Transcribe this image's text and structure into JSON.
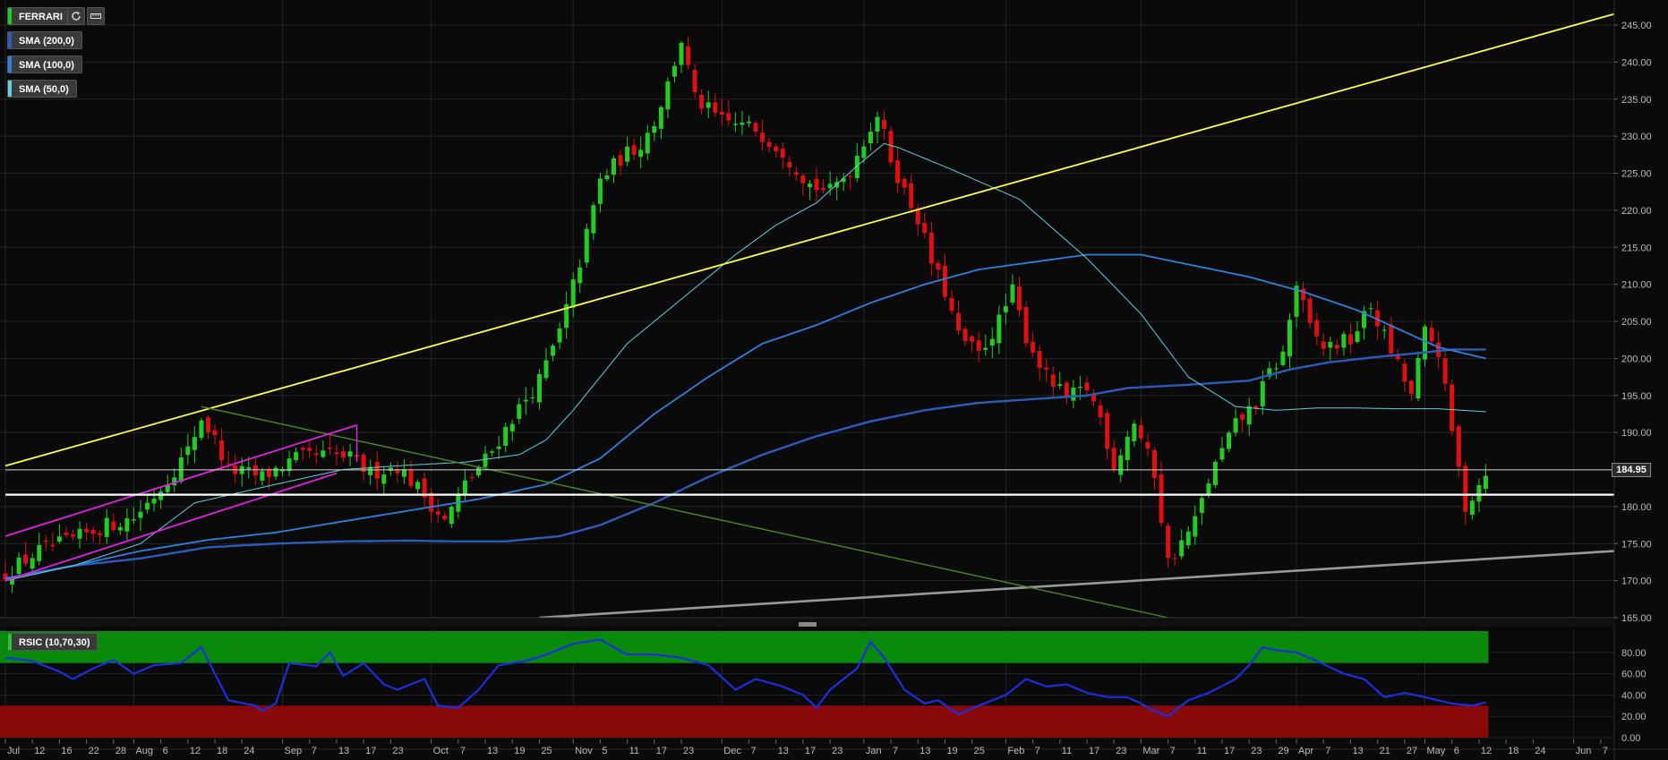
{
  "symbol": "FERRARI",
  "indicators": [
    {
      "label": "SMA (200,0)",
      "color": "#2c5cbb"
    },
    {
      "label": "SMA (100,0)",
      "color": "#2f7fe0"
    },
    {
      "label": "SMA (50,0)",
      "color": "#5fd0e0"
    }
  ],
  "oscillator_label": "RSIC (10,70,30)",
  "last_price_label": "184.95",
  "icons": {
    "refresh": "refresh-icon",
    "settings": "ruler-icon"
  },
  "colors": {
    "up": "#22cc22",
    "down": "#e01010",
    "trend_yellow": "#ffff44",
    "channel": "#e020e0",
    "downtrend": "#4a8a20",
    "support_gray": "#999999",
    "rsi_line": "#1c2ee0",
    "rsi_overbought_zone": "#0a8a0a",
    "rsi_oversold_zone": "#8a0a0a",
    "horizontal_level": "#ffffff"
  },
  "chart_data": [
    {
      "type": "candlestick",
      "title": "FERRARI",
      "ylim": [
        165,
        245
      ],
      "y_ticks": [
        "245.00",
        "240.00",
        "235.00",
        "230.00",
        "225.00",
        "220.00",
        "215.00",
        "210.00",
        "205.00",
        "200.00",
        "195.00",
        "190.00",
        "185.00",
        "180.00",
        "175.00",
        "170.00",
        "165.00"
      ],
      "x_ticks": [
        {
          "i": 0,
          "label": "Jul"
        },
        {
          "i": 4,
          "label": "12"
        },
        {
          "i": 8,
          "label": "16"
        },
        {
          "i": 12,
          "label": "22"
        },
        {
          "i": 16,
          "label": "28"
        },
        {
          "i": 19,
          "label": "Aug"
        },
        {
          "i": 23,
          "label": "6"
        },
        {
          "i": 27,
          "label": "12"
        },
        {
          "i": 31,
          "label": "18"
        },
        {
          "i": 35,
          "label": "24"
        },
        {
          "i": 41,
          "label": "Sep"
        },
        {
          "i": 45,
          "label": "7"
        },
        {
          "i": 49,
          "label": "13"
        },
        {
          "i": 53,
          "label": "17"
        },
        {
          "i": 57,
          "label": "23"
        },
        {
          "i": 63,
          "label": "Oct"
        },
        {
          "i": 67,
          "label": "7"
        },
        {
          "i": 71,
          "label": "13"
        },
        {
          "i": 75,
          "label": "19"
        },
        {
          "i": 79,
          "label": "25"
        },
        {
          "i": 84,
          "label": "Nov"
        },
        {
          "i": 88,
          "label": "5"
        },
        {
          "i": 92,
          "label": "11"
        },
        {
          "i": 96,
          "label": "17"
        },
        {
          "i": 100,
          "label": "23"
        },
        {
          "i": 106,
          "label": "Dec"
        },
        {
          "i": 110,
          "label": "7"
        },
        {
          "i": 114,
          "label": "13"
        },
        {
          "i": 118,
          "label": "17"
        },
        {
          "i": 122,
          "label": "23"
        },
        {
          "i": 127,
          "label": "Jan"
        },
        {
          "i": 131,
          "label": "7"
        },
        {
          "i": 135,
          "label": "13"
        },
        {
          "i": 139,
          "label": "19"
        },
        {
          "i": 143,
          "label": "25"
        },
        {
          "i": 148,
          "label": "Feb"
        },
        {
          "i": 152,
          "label": "7"
        },
        {
          "i": 156,
          "label": "11"
        },
        {
          "i": 160,
          "label": "17"
        },
        {
          "i": 164,
          "label": "23"
        },
        {
          "i": 168,
          "label": "Mar"
        },
        {
          "i": 172,
          "label": "7"
        },
        {
          "i": 176,
          "label": "11"
        },
        {
          "i": 180,
          "label": "17"
        },
        {
          "i": 184,
          "label": "23"
        },
        {
          "i": 188,
          "label": "29"
        },
        {
          "i": 191,
          "label": "Apr"
        },
        {
          "i": 195,
          "label": "7"
        },
        {
          "i": 199,
          "label": "13"
        },
        {
          "i": 203,
          "label": "21"
        },
        {
          "i": 207,
          "label": "27"
        },
        {
          "i": 210,
          "label": "May"
        },
        {
          "i": 214,
          "label": "6"
        },
        {
          "i": 218,
          "label": "12"
        },
        {
          "i": 222,
          "label": "18"
        },
        {
          "i": 226,
          "label": "24"
        },
        {
          "i": 232,
          "label": "Jun"
        },
        {
          "i": 236,
          "label": "7"
        }
      ],
      "close_path": [
        [
          0,
          171
        ],
        [
          5,
          174
        ],
        [
          10,
          175.5
        ],
        [
          15,
          177.5
        ],
        [
          19,
          178.5
        ],
        [
          23,
          182.5
        ],
        [
          27,
          187.5
        ],
        [
          29,
          192
        ],
        [
          31,
          189
        ],
        [
          33,
          185
        ],
        [
          38,
          184
        ],
        [
          43,
          186.5
        ],
        [
          48,
          187
        ],
        [
          51,
          186.5
        ],
        [
          54,
          184.5
        ],
        [
          58,
          185.5
        ],
        [
          62,
          181.5
        ],
        [
          65,
          178
        ],
        [
          68,
          183
        ],
        [
          72,
          187.5
        ],
        [
          75,
          192
        ],
        [
          79,
          197
        ],
        [
          82,
          203.5
        ],
        [
          85,
          213
        ],
        [
          88,
          224
        ],
        [
          91,
          227
        ],
        [
          94,
          229
        ],
        [
          96,
          232
        ],
        [
          98,
          237
        ],
        [
          100,
          243
        ],
        [
          102,
          235
        ],
        [
          106,
          232
        ],
        [
          111,
          231
        ],
        [
          115,
          228
        ],
        [
          119,
          223.5
        ],
        [
          122,
          222.5
        ],
        [
          125,
          225.5
        ],
        [
          127,
          229.5
        ],
        [
          129,
          233
        ],
        [
          131,
          227
        ],
        [
          133,
          222.5
        ],
        [
          135,
          219
        ],
        [
          137,
          213
        ],
        [
          139,
          209
        ],
        [
          141,
          203
        ],
        [
          144,
          200.5
        ],
        [
          147,
          205
        ],
        [
          149,
          209
        ],
        [
          151,
          203
        ],
        [
          154,
          197.5
        ],
        [
          157,
          194.5
        ],
        [
          160,
          196
        ],
        [
          162,
          192
        ],
        [
          164,
          185.5
        ],
        [
          167,
          191.5
        ],
        [
          170,
          184.5
        ],
        [
          172,
          172.5
        ],
        [
          174,
          175
        ],
        [
          176,
          178
        ],
        [
          178,
          183.5
        ],
        [
          180,
          187.5
        ],
        [
          182,
          191
        ],
        [
          185,
          194
        ],
        [
          187,
          198
        ],
        [
          189,
          200.5
        ],
        [
          191,
          210
        ],
        [
          193,
          204
        ],
        [
          195,
          201.5
        ],
        [
          199,
          202.5
        ],
        [
          202,
          207
        ],
        [
          204,
          203
        ],
        [
          206,
          199
        ],
        [
          208,
          195
        ],
        [
          210,
          203.5
        ],
        [
          212,
          201
        ],
        [
          214,
          190
        ],
        [
          216,
          180
        ],
        [
          218,
          183
        ],
        [
          219,
          185
        ]
      ],
      "sma50_path": [
        [
          0,
          170
        ],
        [
          10,
          172
        ],
        [
          20,
          175
        ],
        [
          28,
          180.5
        ],
        [
          40,
          183
        ],
        [
          50,
          185
        ],
        [
          58,
          185.5
        ],
        [
          68,
          186
        ],
        [
          76,
          187
        ],
        [
          80,
          189
        ],
        [
          84,
          193
        ],
        [
          92,
          202
        ],
        [
          100,
          208
        ],
        [
          108,
          214
        ],
        [
          114,
          218
        ],
        [
          120,
          221
        ],
        [
          126,
          226
        ],
        [
          130,
          229
        ],
        [
          132,
          228.5
        ],
        [
          136,
          227
        ],
        [
          140,
          225.5
        ],
        [
          150,
          221.5
        ],
        [
          160,
          213.5
        ],
        [
          168,
          206
        ],
        [
          175,
          197.5
        ],
        [
          182,
          193.5
        ],
        [
          188,
          193
        ],
        [
          194,
          193.3
        ],
        [
          200,
          193.3
        ],
        [
          206,
          193.2
        ],
        [
          212,
          193.2
        ],
        [
          219,
          192.8
        ]
      ],
      "sma100_path": [
        [
          0,
          170.3
        ],
        [
          10,
          172
        ],
        [
          20,
          174
        ],
        [
          30,
          175.5
        ],
        [
          40,
          176.5
        ],
        [
          50,
          178
        ],
        [
          60,
          179.5
        ],
        [
          70,
          181
        ],
        [
          80,
          183
        ],
        [
          88,
          186.5
        ],
        [
          96,
          192.5
        ],
        [
          104,
          197.5
        ],
        [
          112,
          202
        ],
        [
          120,
          204.5
        ],
        [
          128,
          207.5
        ],
        [
          136,
          210
        ],
        [
          144,
          212
        ],
        [
          152,
          213
        ],
        [
          160,
          214
        ],
        [
          168,
          214
        ],
        [
          176,
          212.5
        ],
        [
          184,
          211
        ],
        [
          192,
          209
        ],
        [
          200,
          206.5
        ],
        [
          206,
          204
        ],
        [
          212,
          201.5
        ],
        [
          219,
          200
        ]
      ],
      "sma200_path": [
        [
          0,
          170.3
        ],
        [
          10,
          172
        ],
        [
          20,
          173
        ],
        [
          30,
          174.5
        ],
        [
          40,
          175
        ],
        [
          50,
          175.3
        ],
        [
          60,
          175.4
        ],
        [
          66,
          175.3
        ],
        [
          74,
          175.3
        ],
        [
          82,
          176
        ],
        [
          88,
          177.5
        ],
        [
          96,
          180.5
        ],
        [
          104,
          184
        ],
        [
          112,
          187
        ],
        [
          120,
          189.5
        ],
        [
          128,
          191.5
        ],
        [
          136,
          193
        ],
        [
          144,
          194
        ],
        [
          152,
          194.5
        ],
        [
          160,
          195
        ],
        [
          166,
          196
        ],
        [
          176,
          196.5
        ],
        [
          184,
          197
        ],
        [
          190,
          198.5
        ],
        [
          196,
          199.5
        ],
        [
          204,
          200.3
        ],
        [
          210,
          200.8
        ],
        [
          214,
          201.2
        ],
        [
          219,
          201.2
        ]
      ],
      "trendlines": [
        {
          "name": "rising-resistance",
          "from": [
            0,
            185.5
          ],
          "to": [
            240,
            246.5
          ]
        },
        {
          "name": "long-term-support",
          "from": [
            79,
            165
          ],
          "to": [
            240,
            174
          ]
        },
        {
          "name": "falling-trendline",
          "from": [
            29,
            193.5
          ],
          "to": [
            172,
            165
          ]
        },
        {
          "name": "channel-upper",
          "from": [
            0,
            176
          ],
          "to": [
            52,
            191
          ]
        },
        {
          "name": "channel-lower",
          "from": [
            0,
            170
          ],
          "to": [
            49,
            184.5
          ]
        },
        {
          "name": "horizontal-support",
          "from": [
            0,
            181.6
          ],
          "to": [
            240,
            181.6
          ]
        },
        {
          "name": "last-price",
          "from": [
            0,
            184.95
          ],
          "to": [
            240,
            184.95
          ]
        }
      ],
      "last_price": 184.95
    },
    {
      "type": "line",
      "title": "RSIC (10,70,30)",
      "ylim": [
        0,
        100
      ],
      "y_ticks": [
        "80.00",
        "60.00",
        "40.00",
        "20.00",
        "0.00"
      ],
      "zones": [
        {
          "from": 70,
          "to": 100,
          "name": "overbought"
        },
        {
          "from": 0,
          "to": 30,
          "name": "oversold"
        }
      ],
      "rsi_path": [
        [
          0,
          75
        ],
        [
          4,
          72
        ],
        [
          8,
          62
        ],
        [
          10,
          55
        ],
        [
          13,
          65
        ],
        [
          16,
          73
        ],
        [
          19,
          60
        ],
        [
          22,
          68
        ],
        [
          26,
          70
        ],
        [
          29,
          85
        ],
        [
          31,
          60
        ],
        [
          33,
          35
        ],
        [
          37,
          30
        ],
        [
          38,
          25
        ],
        [
          40,
          32
        ],
        [
          42,
          70
        ],
        [
          46,
          67
        ],
        [
          48,
          80
        ],
        [
          50,
          58
        ],
        [
          53,
          70
        ],
        [
          56,
          50
        ],
        [
          58,
          45
        ],
        [
          62,
          55
        ],
        [
          64,
          30
        ],
        [
          67,
          28
        ],
        [
          70,
          45
        ],
        [
          73,
          68
        ],
        [
          77,
          72
        ],
        [
          80,
          78
        ],
        [
          84,
          88
        ],
        [
          88,
          92
        ],
        [
          92,
          78
        ],
        [
          96,
          78
        ],
        [
          100,
          75
        ],
        [
          104,
          68
        ],
        [
          108,
          45
        ],
        [
          111,
          55
        ],
        [
          115,
          48
        ],
        [
          118,
          40
        ],
        [
          120,
          28
        ],
        [
          122,
          45
        ],
        [
          126,
          65
        ],
        [
          128,
          90
        ],
        [
          130,
          75
        ],
        [
          133,
          45
        ],
        [
          136,
          32
        ],
        [
          138,
          35
        ],
        [
          141,
          22
        ],
        [
          144,
          30
        ],
        [
          148,
          40
        ],
        [
          151,
          55
        ],
        [
          154,
          48
        ],
        [
          157,
          50
        ],
        [
          160,
          42
        ],
        [
          163,
          38
        ],
        [
          166,
          38
        ],
        [
          168,
          32
        ],
        [
          170,
          25
        ],
        [
          172,
          20
        ],
        [
          175,
          35
        ],
        [
          178,
          42
        ],
        [
          182,
          55
        ],
        [
          184,
          68
        ],
        [
          186,
          85
        ],
        [
          188,
          82
        ],
        [
          191,
          80
        ],
        [
          194,
          72
        ],
        [
          198,
          60
        ],
        [
          201,
          55
        ],
        [
          204,
          38
        ],
        [
          207,
          42
        ],
        [
          210,
          38
        ],
        [
          214,
          32
        ],
        [
          217,
          30
        ],
        [
          219,
          33
        ]
      ]
    }
  ]
}
